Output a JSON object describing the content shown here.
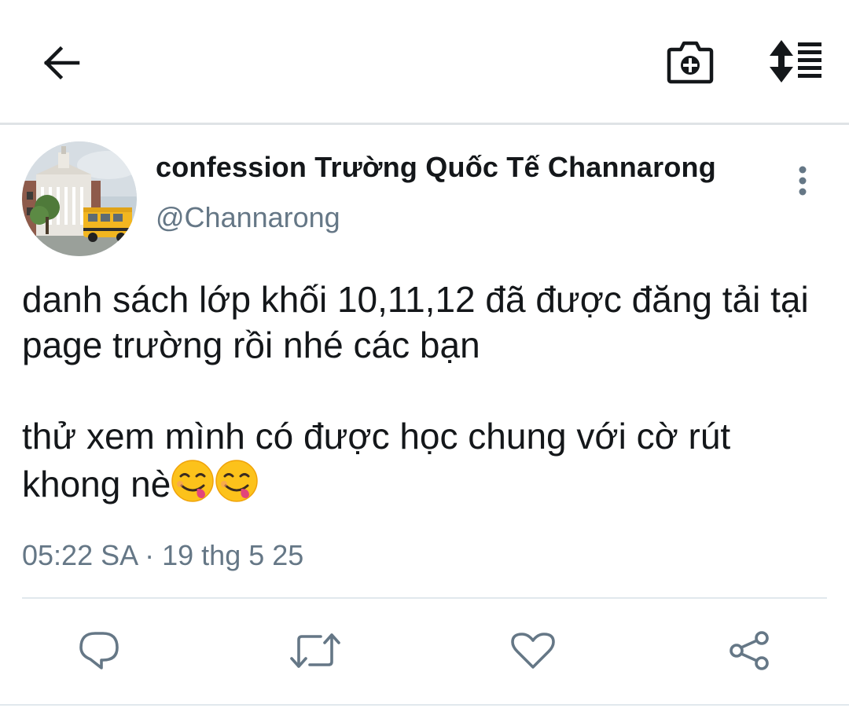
{
  "toolbar": {
    "back_icon": "arrow-left-icon",
    "camera_icon": "camera-plus-icon",
    "sort_icon": "sort-list-icon"
  },
  "tweet": {
    "display_name": "confession Trường Quốc Tế Channarong",
    "handle": "@Channarong",
    "text": "danh sách lớp khối 10,11,12 đã được đăng tải tại page trường rồi nhé các bạn\n\nthử xem mình có được học chung với cờ rút khong nè",
    "emojis": [
      "face-savoring-food",
      "face-savoring-food"
    ],
    "timestamp": "05:22 SA · 19 thg 5 25",
    "more_icon": "more-vertical-icon"
  },
  "actions": {
    "reply_icon": "reply-icon",
    "retweet_icon": "retweet-icon",
    "like_icon": "heart-icon",
    "share_icon": "share-icon"
  },
  "colors": {
    "primary_text": "#14171a",
    "secondary_text": "#657786",
    "divider": "#e1e8ed"
  }
}
